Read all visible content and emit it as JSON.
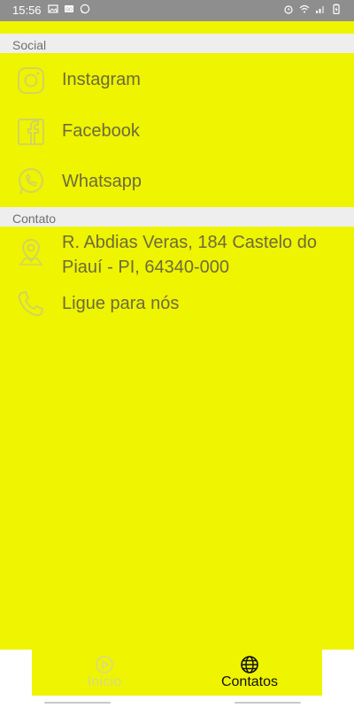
{
  "status_bar": {
    "time": "15:56",
    "left_icons": [
      "image-icon",
      "qr-icon",
      "whatsapp-icon"
    ],
    "right_icons": [
      "alarm-icon",
      "wifi-icon",
      "signal-icon",
      "battery-icon"
    ]
  },
  "sections": {
    "social": {
      "title": "Social",
      "items": [
        {
          "label": "Instagram",
          "icon": "instagram-icon"
        },
        {
          "label": "Facebook",
          "icon": "facebook-icon"
        },
        {
          "label": "Whatsapp",
          "icon": "whatsapp-icon"
        }
      ]
    },
    "contato": {
      "title": "Contato",
      "items": [
        {
          "label": "R. Abdias Veras, 184 Castelo do",
          "label_line2": "Piauí - PI, 64340-000",
          "icon": "location-icon"
        },
        {
          "label": "Ligue para nós",
          "icon": "phone-icon"
        }
      ]
    }
  },
  "bottom_nav": {
    "items": [
      {
        "label": "Início",
        "icon": "play-circle-icon",
        "active": false
      },
      {
        "label": "Contatos",
        "icon": "globe-icon",
        "active": true
      }
    ]
  },
  "colors": {
    "background": "#eff400",
    "status_bar": "#8e8e8e",
    "section_header": "#eeeeee",
    "text": "#6c6c3a",
    "icon": "#d4d45a"
  }
}
